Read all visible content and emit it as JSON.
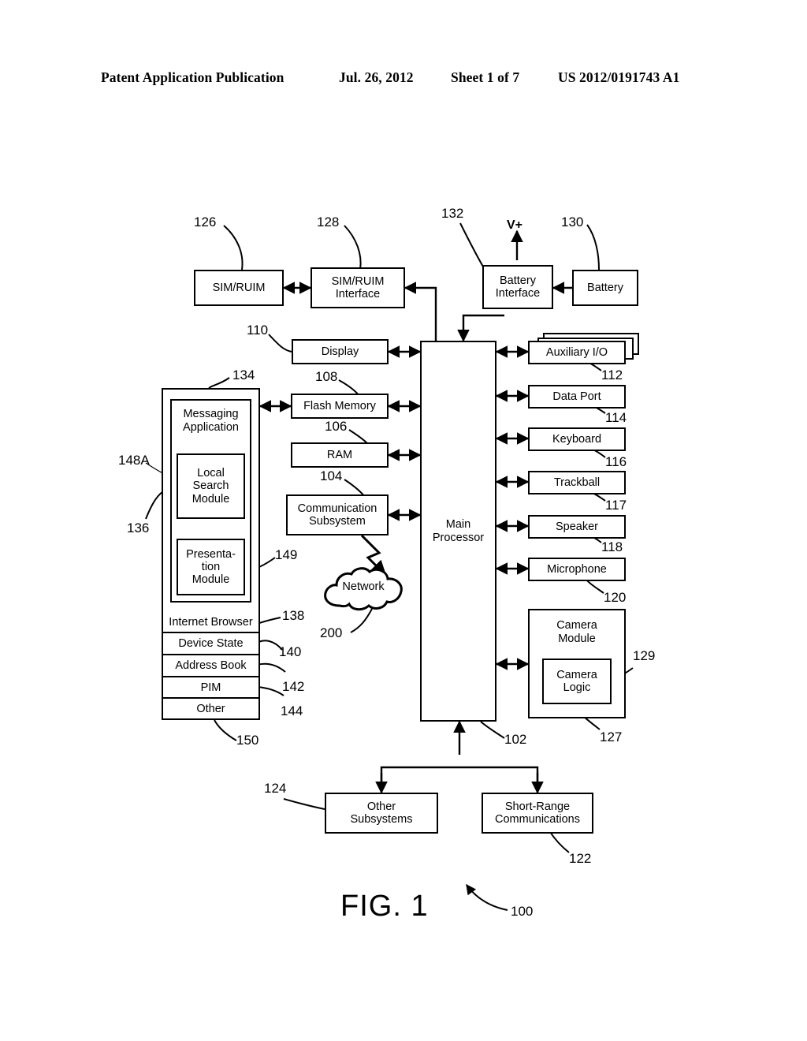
{
  "header": {
    "title": "Patent Application Publication",
    "date": "Jul. 26, 2012",
    "sheet": "Sheet 1 of 7",
    "publication_number": "US 2012/0191743 A1"
  },
  "figure": {
    "caption": "FIG. 1",
    "system_ref": "100",
    "power_label": "V+"
  },
  "blocks": {
    "sim_ruim": "SIM/RUIM",
    "sim_ruim_interface": "SIM/RUIM\nInterface",
    "battery_interface": "Battery\nInterface",
    "battery": "Battery",
    "display": "Display",
    "flash_memory": "Flash Memory",
    "ram": "RAM",
    "communication_subsystem": "Communication\nSubsystem",
    "network": "Network",
    "main_processor": "Main\nProcessor",
    "auxiliary_io": "Auxiliary I/O",
    "data_port": "Data Port",
    "keyboard": "Keyboard",
    "trackball": "Trackball",
    "speaker": "Speaker",
    "microphone": "Microphone",
    "camera_module": "Camera\nModule",
    "camera_logic": "Camera\nLogic",
    "other_subsystems": "Other\nSubsystems",
    "short_range_communications": "Short-Range\nCommunications",
    "messaging_application": "Messaging\nApplication",
    "local_search_module": "Local\nSearch\nModule",
    "presentation_module": "Presenta-\ntion\nModule",
    "internet_browser": "Internet Browser",
    "device_state": "Device State",
    "address_book": "Address Book",
    "pim": "PIM",
    "other": "Other"
  },
  "refs": {
    "r126": "126",
    "r128": "128",
    "r132": "132",
    "r130": "130",
    "r110": "110",
    "r108": "108",
    "r106": "106",
    "r104": "104",
    "r134": "134",
    "r148A": "148A",
    "r136": "136",
    "r149": "149",
    "r138": "138",
    "r140": "140",
    "r142": "142",
    "r144": "144",
    "r150": "150",
    "r200": "200",
    "r112": "112",
    "r114": "114",
    "r116": "116",
    "r117": "117",
    "r118": "118",
    "r120": "120",
    "r129": "129",
    "r127": "127",
    "r102": "102",
    "r124": "124",
    "r122": "122",
    "r100": "100"
  },
  "colors": {
    "line": "#000000",
    "background": "#ffffff"
  }
}
